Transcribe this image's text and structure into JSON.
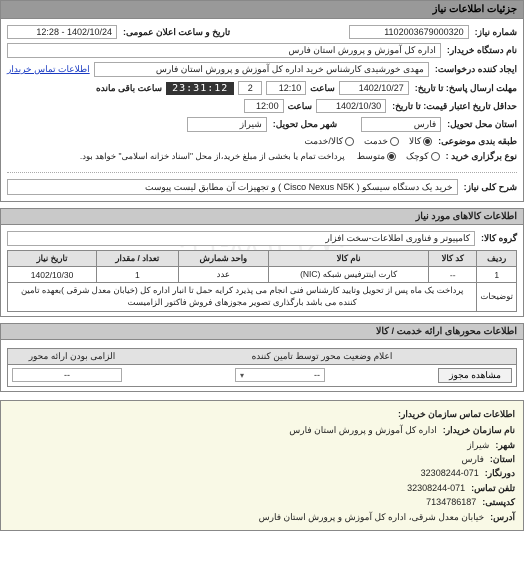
{
  "watermark": "۰۲۱-۸۸۹۴۹۶۷۰",
  "section_need_title": "جزئیات اطلاعات نیاز",
  "fields": {
    "req_no_lbl": "شماره نیاز:",
    "req_no": "1102003679000320",
    "announce_lbl": "تاریخ و ساعت اعلان عمومی:",
    "announce": "1402/10/24 - 12:28",
    "buyer_org_lbl": "نام دستگاه خریدار:",
    "buyer_org": "اداره کل آموزش و پرورش استان فارس",
    "requester_lbl": "ایجاد کننده درخواست:",
    "requester": "مهدی خورشیدی کارشناس خرید اداره کل آموزش و پرورش استان فارس",
    "contact_link": "اطلاعات تماس خریدار",
    "deadline_to_lbl": "مهلت ارسال پاسخ: تا تاریخ:",
    "deadline_date": "1402/10/27",
    "time_lbl": "ساعت",
    "deadline_time": "12:10",
    "days_remain": "2",
    "remain_clock": "23:31:12",
    "remain_suffix": "ساعت باقی مانده",
    "valid_to_lbl": "حداقل تاریخ اعتبار قیمت: تا تاریخ:",
    "valid_date": "1402/10/30",
    "valid_time": "12:00",
    "province_lbl": "استان محل تحویل:",
    "province": "فارس",
    "city_lbl": "شهر محل تحویل:",
    "city": "شیراز",
    "cat_lbl": "طبقه بندی موضوعی:",
    "cat_goods": "کالا",
    "cat_service": "خدمت",
    "cat_both": "کالا/خدمت",
    "purchase_lbl": "نوع برگزاری خرید :",
    "p_small": "کوچک",
    "p_medium": "متوسط",
    "p_note": "پرداخت تمام یا بخشی از مبلغ خرید،از محل \"اسناد خزانه اسلامی\" خواهد بود.",
    "summary_lbl": "شرح کلی نیاز:",
    "summary": "خرید یک دستگاه سیسکو ( Cisco Nexus N5K ) و تجهیزات آن مطابق لیست پیوست"
  },
  "goods_section_title": "اطلاعات کالاهای مورد نیاز",
  "goods_group_lbl": "گروه کالا:",
  "goods_group": "کامپیوتر و فناوری اطلاعات-سخت افزار",
  "cols": {
    "row": "ردیف",
    "code": "کد کالا",
    "name": "نام کالا",
    "unit": "واحد شمارش",
    "qty": "تعداد / مقدار",
    "need_date": "تاریخ نیاز"
  },
  "item": {
    "row": "1",
    "code": "--",
    "name": "کارت اینترفیس شبکه (NIC)",
    "unit": "عدد",
    "qty": "1",
    "need_date": "1402/10/30"
  },
  "desc_lbl": "توضیحات",
  "desc": "پرداخت یک ماه پس از تحویل وتایید کارشناس فنی انجام می پذیرد کرایه حمل تا انبار اداره کل (خیابان معدل شرقی )بعهده تامین کننده می باشد بارگذاری تصویر مجوزهای فروش فاکتور الزامیست",
  "axes_title": "اطلاعات محورهای ارائه خدمت / کالا",
  "axes_mandatory_lbl": "الزامی بودن ارائه محور",
  "axes_status_lbl": "اعلام وضعیت محور توسط تامین کننده",
  "axes_select": "--",
  "axes_btn": "مشاهده مجوز",
  "contact_box_title": "اطلاعات تماس سازمان خریدار:",
  "contact": {
    "org_lbl": "نام سازمان خریدار:",
    "org": "اداره کل آموزش و پرورش استان فارس",
    "city_lbl": "شهر:",
    "city": "شیراز",
    "prov_lbl": "استان:",
    "prov": "فارس",
    "tel_lbl": "دورنگار:",
    "tel": "32308244-071",
    "phone_lbl": "تلفن تماس:",
    "phone": "32308244-071",
    "postal_lbl": "کدپستی:",
    "postal": "7134786187",
    "addr_lbl": "آدرس:",
    "addr": "خیابان معدل شرقی، اداره کل آموزش و پرورش استان فارس"
  }
}
